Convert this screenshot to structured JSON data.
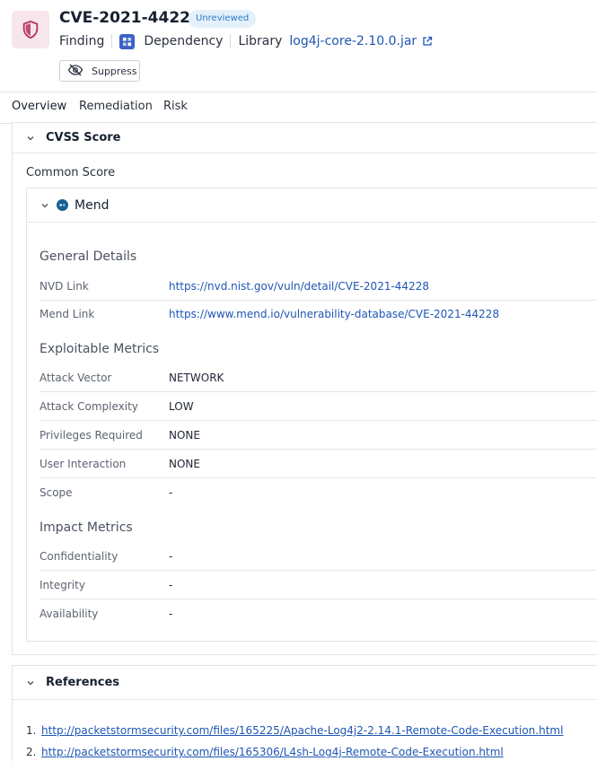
{
  "header": {
    "title": "CVE-2021-44228",
    "status_badge": "Unreviewed",
    "meta": {
      "type": "Finding",
      "category": "Dependency",
      "library_label": "Library",
      "library_name": "log4j-core-2.10.0.jar"
    },
    "suppress_label": "Suppress",
    "icons": {
      "main": "shield-icon",
      "dependency": "dependency-icon",
      "external": "external-link-icon",
      "suppress": "eye-off-icon"
    }
  },
  "tabs": [
    {
      "label": "Overview",
      "active": true
    },
    {
      "label": "Remediation",
      "active": false
    },
    {
      "label": "Risk",
      "active": false
    }
  ],
  "cvss": {
    "title": "CVSS Score",
    "common_score_label": "Common Score",
    "source": "Mend",
    "general": {
      "title": "General Details",
      "rows": [
        {
          "label": "NVD Link",
          "value": "https://nvd.nist.gov/vuln/detail/CVE-2021-44228"
        },
        {
          "label": "Mend Link",
          "value": "https://www.mend.io/vulnerability-database/CVE-2021-44228"
        }
      ]
    },
    "exploitable": {
      "title": "Exploitable Metrics",
      "rows": [
        {
          "label": "Attack Vector",
          "value": "NETWORK"
        },
        {
          "label": "Attack Complexity",
          "value": "LOW"
        },
        {
          "label": "Privileges Required",
          "value": "NONE"
        },
        {
          "label": "User Interaction",
          "value": "NONE"
        },
        {
          "label": "Scope",
          "value": "-"
        }
      ]
    },
    "impact": {
      "title": "Impact Metrics",
      "rows": [
        {
          "label": "Confidentiality",
          "value": "-"
        },
        {
          "label": "Integrity",
          "value": "-"
        },
        {
          "label": "Availability",
          "value": "-"
        }
      ]
    }
  },
  "references": {
    "title": "References",
    "items": [
      {
        "num": "1.",
        "url": "http://packetstormsecurity.com/files/165225/Apache-Log4j2-2.14.1-Remote-Code-Execution.html"
      },
      {
        "num": "2.",
        "url": "http://packetstormsecurity.com/files/165306/L4sh-Log4j-Remote-Code-Execution.html"
      }
    ]
  },
  "colors": {
    "accent": "#1f56b4",
    "shield": "#b8335e",
    "badge_bg": "#e4f1fb",
    "badge_text": "#2b7ac7"
  }
}
